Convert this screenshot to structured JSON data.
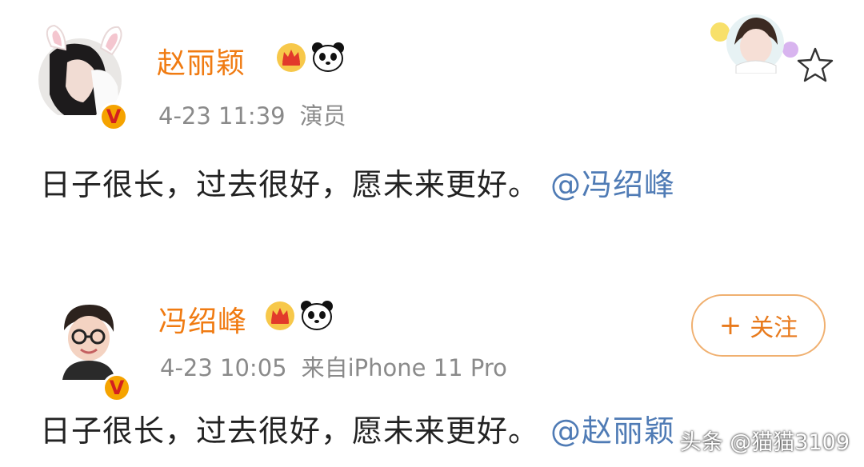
{
  "post1": {
    "username": "赵丽颖",
    "timestamp": "4-23 11:39",
    "source": "演员",
    "text": "日子很长，过去很好，愿未来更好。",
    "mention": "@冯绍峰"
  },
  "post2": {
    "username": "冯绍峰",
    "timestamp": "4-23 10:05",
    "source": "来自iPhone 11 Pro",
    "text": "日子很长，过去很好，愿未来更好。",
    "mention": "@赵丽颖",
    "follow_label": "关注",
    "follow_plus": "+"
  },
  "watermark": "头条 @猫猫3109",
  "verified_badge": "V",
  "colors": {
    "username": "#f07b12",
    "meta": "#8a8a8a",
    "mention": "#4f7bb5",
    "badge": "#f5a300",
    "follow_border": "#f0b070"
  },
  "icons": [
    "verified-badge-icon",
    "crown-icon",
    "panda-icon",
    "star-icon",
    "plus-icon"
  ]
}
